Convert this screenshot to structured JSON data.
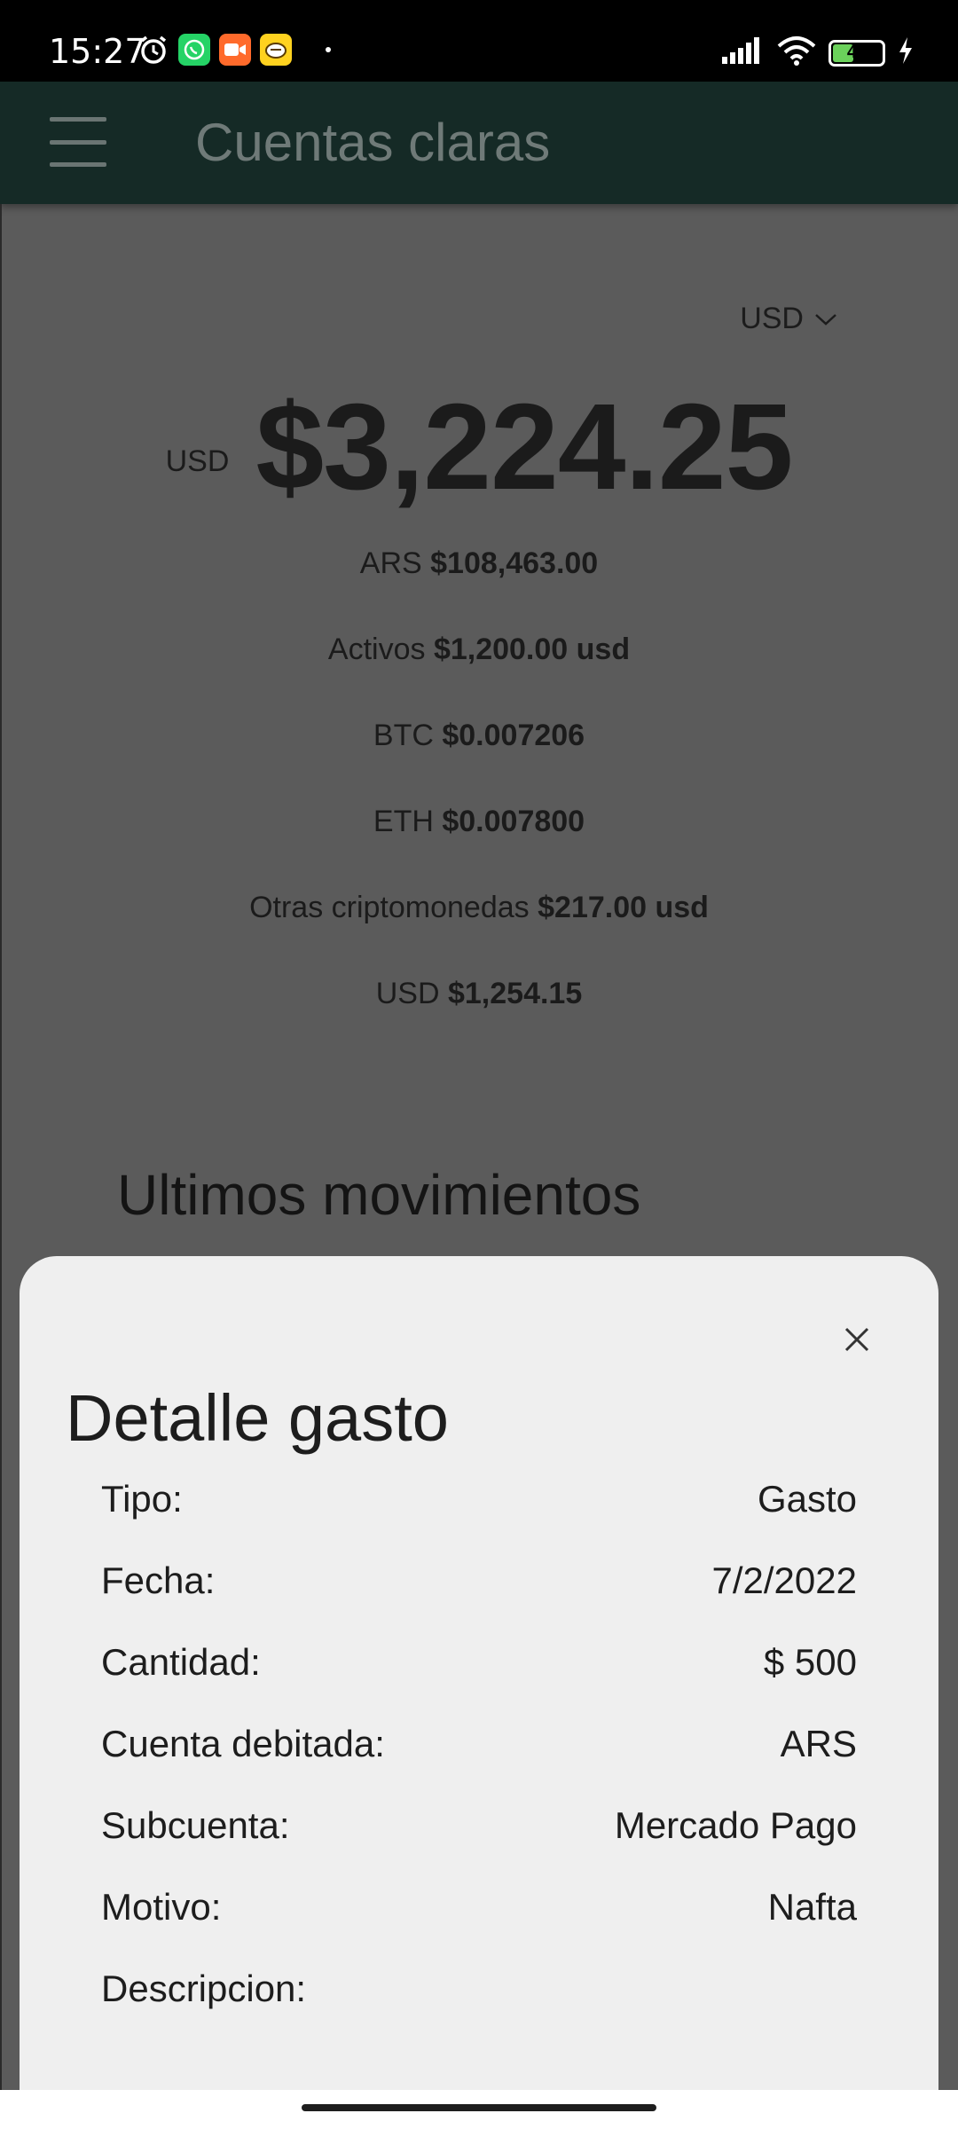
{
  "status_bar": {
    "time": "15:27",
    "battery": "47"
  },
  "toolbar": {
    "title": "Cuentas claras"
  },
  "currency_select": {
    "value": "USD"
  },
  "main_balance": {
    "currency": "USD",
    "amount": "$3,224.25"
  },
  "balances": [
    {
      "label": "ARS",
      "value": "$108,463.00"
    },
    {
      "label": "Activos",
      "value": "$1,200.00 usd"
    },
    {
      "label": "BTC",
      "value": "$0.007206"
    },
    {
      "label": "ETH",
      "value": "$0.007800"
    },
    {
      "label": "Otras criptomonedas",
      "value": "$217.00 usd"
    },
    {
      "label": "USD",
      "value": "$1,254.15"
    }
  ],
  "section": {
    "title": "Ultimos movimientos"
  },
  "detail_sheet": {
    "title": "Detalle gasto",
    "rows": [
      {
        "label": "Tipo:",
        "value": "Gasto"
      },
      {
        "label": "Fecha:",
        "value": "7/2/2022"
      },
      {
        "label": "Cantidad:",
        "value": "$ 500"
      },
      {
        "label": "Cuenta debitada:",
        "value": "ARS"
      },
      {
        "label": "Subcuenta:",
        "value": "Mercado Pago"
      },
      {
        "label": "Motivo:",
        "value": "Nafta"
      },
      {
        "label": "Descripcion:",
        "value": ""
      }
    ]
  },
  "icons": {
    "status_left": [
      "alarm-icon",
      "whatsapp-icon",
      "video-call-icon",
      "game-icon"
    ],
    "status_right": [
      "signal-icon",
      "wifi-icon",
      "battery-icon",
      "charging-icon"
    ]
  },
  "colors": {
    "toolbar_dimmed": "#152a26",
    "scrim_background": "#5b5b5b",
    "sheet_background": "#efefef",
    "whatsapp": "#25d366",
    "video": "#ff6a2b",
    "game": "#ffd21f",
    "battery_fill": "#6bd15b"
  }
}
